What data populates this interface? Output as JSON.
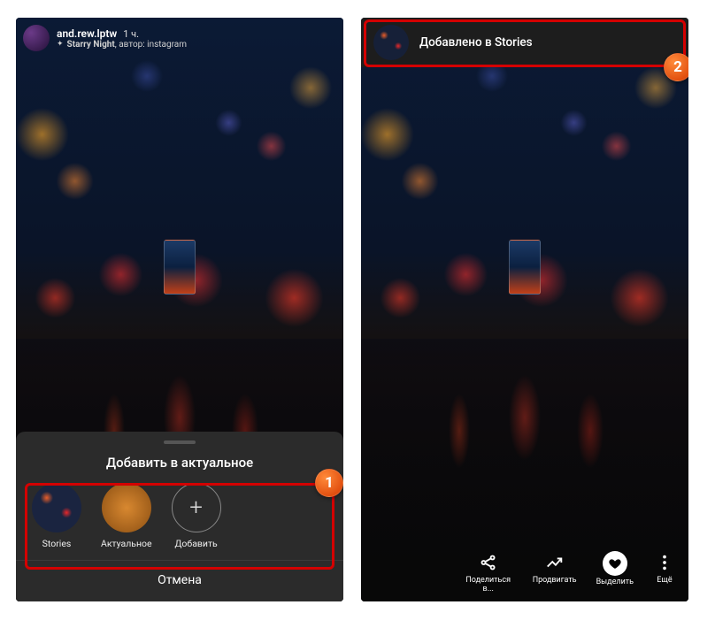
{
  "left": {
    "header": {
      "username": "and.rew.lptw",
      "time": "1 ч.",
      "filter_name": "Starry Night",
      "author_label": "автор: instagram"
    },
    "sheet": {
      "title": "Добавить в актуальное",
      "items": [
        {
          "label": "Stories"
        },
        {
          "label": "Актуальное"
        },
        {
          "label": "Добавить"
        }
      ],
      "cancel": "Отмена"
    }
  },
  "right": {
    "toast": "Добавлено в Stories",
    "actions": [
      {
        "label": "Поделиться в..."
      },
      {
        "label": "Продвигать"
      },
      {
        "label": "Выделить"
      },
      {
        "label": "Ещё"
      }
    ]
  },
  "annotations": {
    "one": "1",
    "two": "2"
  }
}
